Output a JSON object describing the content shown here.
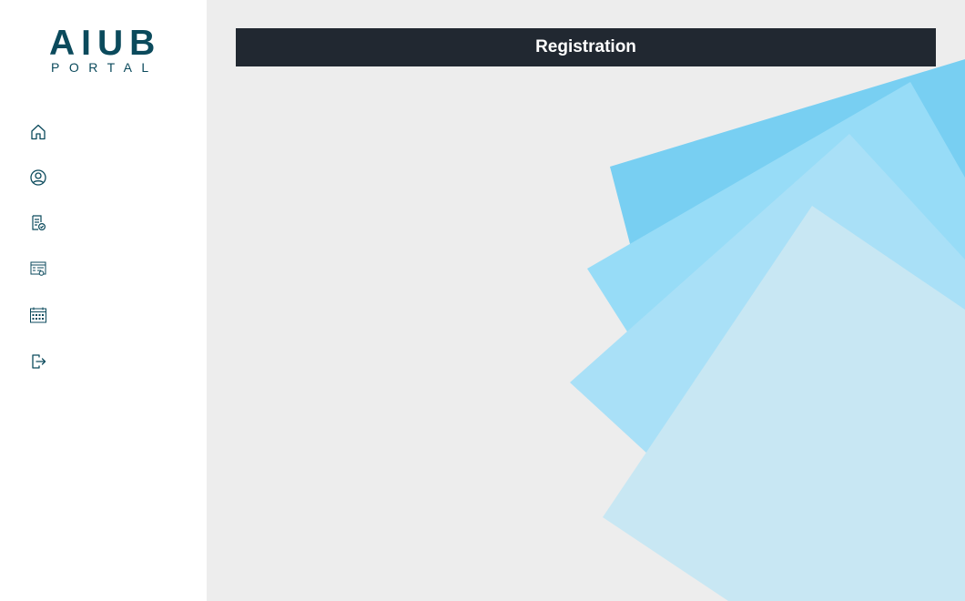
{
  "logo": {
    "main_text": "AIUB",
    "sub_text": "PORTAL"
  },
  "sidebar": {
    "items": [
      {
        "icon": "home-icon"
      },
      {
        "icon": "user-icon"
      },
      {
        "icon": "registration-document-icon"
      },
      {
        "icon": "grades-report-icon"
      },
      {
        "icon": "calendar-icon"
      },
      {
        "icon": "logout-icon"
      }
    ]
  },
  "header": {
    "title": "Registration"
  },
  "colors": {
    "brand": "#0b4a5c",
    "header_bg": "#212831",
    "sidebar_bg": "#ffffff",
    "main_bg": "#ededed",
    "shape_1": "#78cff2",
    "shape_2": "#97dcf7",
    "shape_3": "#a9e0f7",
    "shape_4": "#c8e7f3"
  }
}
